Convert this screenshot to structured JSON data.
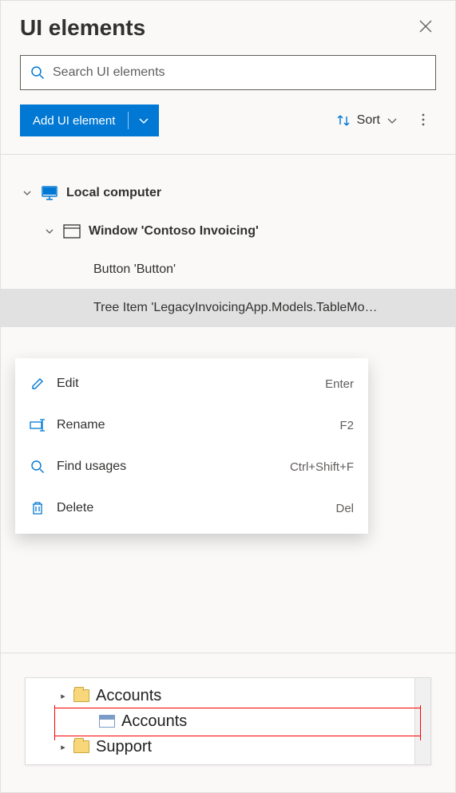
{
  "header": {
    "title": "UI elements"
  },
  "search": {
    "placeholder": "Search UI elements"
  },
  "toolbar": {
    "add_label": "Add UI element",
    "sort_label": "Sort"
  },
  "tree": {
    "root_label": "Local computer",
    "window_label": "Window 'Contoso Invoicing'",
    "items": [
      {
        "label": "Button 'Button'"
      },
      {
        "label": "Tree Item 'LegacyInvoicingApp.Models.TableMo…"
      }
    ]
  },
  "context_menu": {
    "items": [
      {
        "icon": "edit-icon",
        "label": "Edit",
        "shortcut": "Enter"
      },
      {
        "icon": "rename-icon",
        "label": "Rename",
        "shortcut": "F2"
      },
      {
        "icon": "search-icon",
        "label": "Find usages",
        "shortcut": "Ctrl+Shift+F"
      },
      {
        "icon": "delete-icon",
        "label": "Delete",
        "shortcut": "Del"
      }
    ]
  },
  "preview": {
    "rows": [
      {
        "label": "Accounts"
      },
      {
        "label": "Accounts"
      },
      {
        "label": "Support"
      }
    ]
  },
  "colors": {
    "accent": "#0078d4",
    "highlight": "#ff0000"
  }
}
